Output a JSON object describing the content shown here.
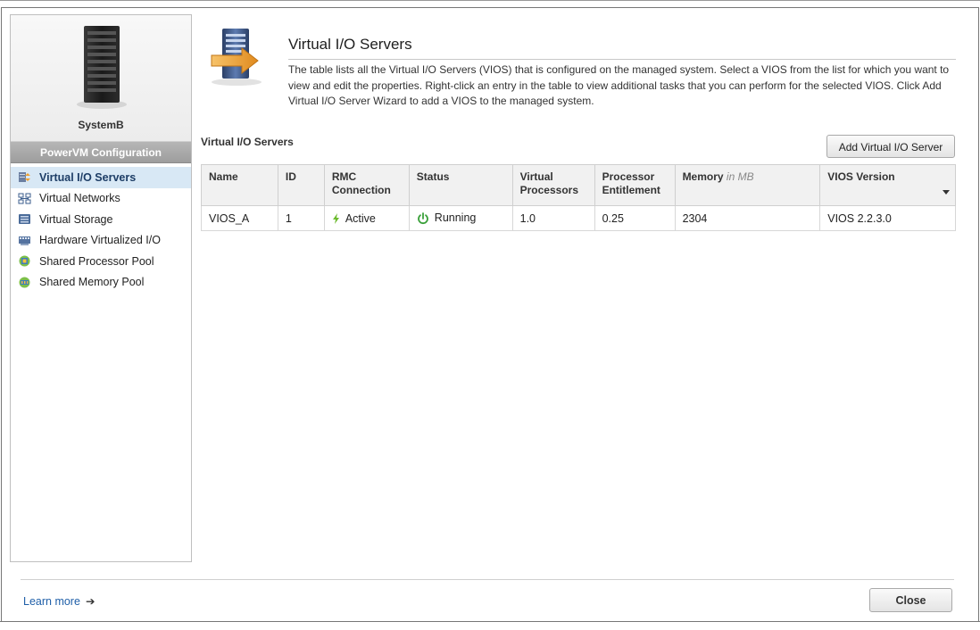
{
  "left_panel": {
    "system_name": "SystemB",
    "section_label": "PowerVM Configuration",
    "nav_items": [
      {
        "label": "Virtual I/O Servers",
        "icon": "vios-icon",
        "active": true
      },
      {
        "label": "Virtual Networks",
        "icon": "network-icon",
        "active": false
      },
      {
        "label": "Virtual Storage",
        "icon": "storage-icon",
        "active": false
      },
      {
        "label": "Hardware Virtualized I/O",
        "icon": "hardware-io-icon",
        "active": false
      },
      {
        "label": "Shared Processor Pool",
        "icon": "processor-pool-icon",
        "active": false
      },
      {
        "label": "Shared Memory Pool",
        "icon": "memory-pool-icon",
        "active": false
      }
    ]
  },
  "header": {
    "title": "Virtual I/O Servers",
    "description": "The table lists all the Virtual I/O Servers (VIOS) that is configured on the managed system. Select a VIOS from the list for which you want to view and edit the properties. Right-click an entry in the table to view additional tasks that you can perform for the selected VIOS. Click Add Virtual I/O Server Wizard to add a VIOS to the managed system."
  },
  "table_section": {
    "label": "Virtual I/O Servers",
    "add_button": "Add Virtual I/O Server",
    "columns": {
      "name": "Name",
      "id": "ID",
      "rmc": "RMC Connection",
      "status": "Status",
      "vproc": "Virtual Processors",
      "entitlement": "Processor Entitlement",
      "memory": "Memory",
      "memory_unit": "in MB",
      "version": "VIOS Version"
    },
    "rows": [
      {
        "name": "VIOS_A",
        "id": "1",
        "rmc": "Active",
        "status": "Running",
        "vproc": "1.0",
        "entitlement": "0.25",
        "memory": "2304",
        "version": "VIOS 2.2.3.0"
      }
    ]
  },
  "footer": {
    "learn_more": "Learn more",
    "close": "Close"
  },
  "colors": {
    "active_nav_bg": "#d8e8f5",
    "link": "#1f5fa8",
    "running_green": "#3aa03a",
    "active_bolt": "#6cbb2e"
  }
}
